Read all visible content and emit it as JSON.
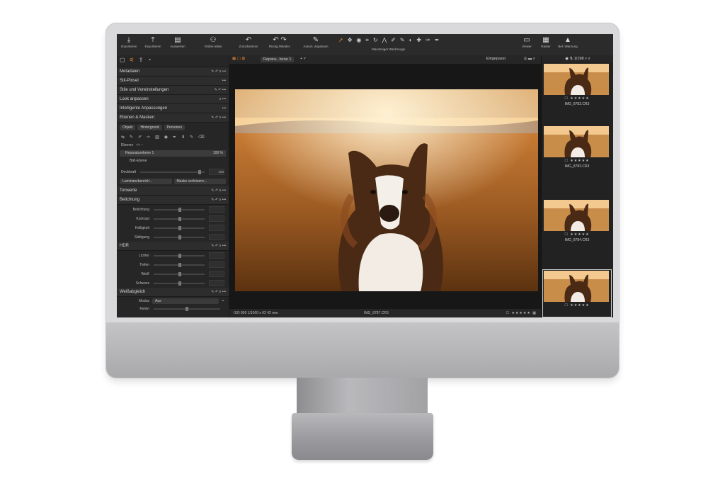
{
  "toolbar": {
    "buttons": [
      {
        "label": "Importieren",
        "icon": "import-icon"
      },
      {
        "label": "Exportieren",
        "icon": "export-icon"
      },
      {
        "label": "Auswerten",
        "icon": "evaluate-icon"
      },
      {
        "label": "Online teilen",
        "icon": "share-icon"
      },
      {
        "label": "Zurücksetzen",
        "icon": "reset-icon"
      },
      {
        "label": "Rückg./Wieder.",
        "icon": "undo-redo-icon"
      },
      {
        "label": "Autom. anpassen",
        "icon": "auto-adjust-icon"
      },
      {
        "label": "Mauszeiger Werkzeuge",
        "icon": "cursor-tools-icon"
      },
      {
        "label": "Viewer",
        "icon": "viewer-icon"
      },
      {
        "label": "Raster",
        "icon": "grid-icon"
      },
      {
        "label": "Bel.-Warnung",
        "icon": "warning-icon"
      }
    ]
  },
  "left_panel": {
    "sections_top": [
      {
        "label": "Metadaten"
      },
      {
        "label": "Stil-Pinsel"
      },
      {
        "label": "Stile und Voreinstellungen"
      },
      {
        "label": "Look anpassen"
      },
      {
        "label": "Intelligente Anpassungen"
      },
      {
        "label": "Ebenen & Masken"
      }
    ],
    "mask_buttons": [
      "Objekt",
      "Hintergrund",
      "Personen"
    ],
    "layers_label": "Ebenen",
    "layer_selected": "Reparaturebene 1",
    "layer_selected_pct": "100 %",
    "layer_base": "Bild-Ebene",
    "opacity_label": "Deckkraft",
    "opacity_value": "100",
    "range_button": "Luminanzbereich...",
    "mask_button": "Maske verfeinern...",
    "tonwerte": "Tonwerte",
    "exposure_title": "Belichtung",
    "exposure_params": [
      "Belichtung",
      "Kontrast",
      "Helligkeit",
      "Sättigung"
    ],
    "hdr_title": "HDR",
    "hdr_params": [
      "Lichter",
      "Tiefen",
      "Weiß",
      "Schwarz"
    ],
    "wb_title": "Weißabgleich",
    "wb_mode_label": "Modus",
    "wb_mode_value": "Aus",
    "wb_kelvin_label": "Kelvin"
  },
  "viewer": {
    "tab": "Repara...bene 1",
    "zoom_label": "Eingepasst",
    "exif": "ISO 800    1/1000 s    f/2    42 mm",
    "filename": "IMG_8787.CR3",
    "stars": "★★★★★"
  },
  "browser": {
    "counter": "1/198",
    "thumbs": [
      {
        "name": "IMG_8782.CR3",
        "stars": "★★★★★"
      },
      {
        "name": "IMG_8783.CR3",
        "stars": "★★★★★"
      },
      {
        "name": "IMG_8784.CR3",
        "stars": "★★★★★"
      },
      {
        "name": "",
        "stars": "★★★★★"
      }
    ]
  }
}
